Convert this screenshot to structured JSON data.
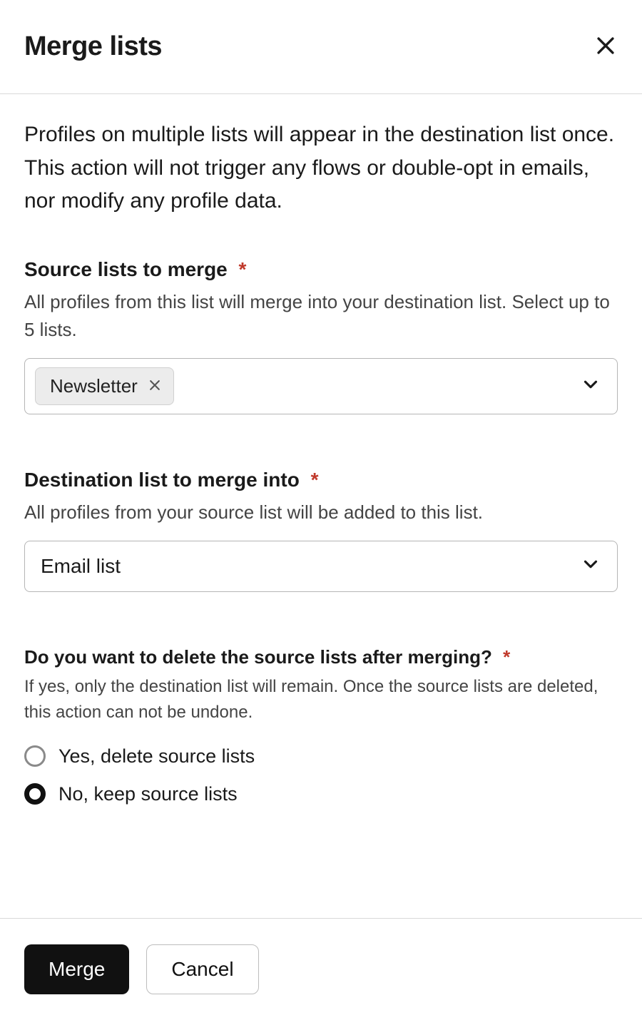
{
  "header": {
    "title": "Merge lists"
  },
  "intro": "Profiles on multiple lists will appear in the destination list once. This action will not trigger any flows or double-opt in emails, nor modify any profile data.",
  "source": {
    "label": "Source lists to merge",
    "required_marker": "*",
    "help": "All profiles from this list will merge into your destination list. Select up to 5 lists.",
    "selected_chips": [
      "Newsletter"
    ]
  },
  "destination": {
    "label": "Destination list to merge into",
    "required_marker": "*",
    "help": "All profiles from your source list will be added to this list.",
    "value": "Email list"
  },
  "delete_question": {
    "label": "Do you want to delete the source lists after merging?",
    "required_marker": "*",
    "help": "If yes, only the destination list will remain. Once the source lists are deleted, this action can not be undone.",
    "options": [
      {
        "label": "Yes, delete source lists",
        "checked": false
      },
      {
        "label": "No, keep source lists",
        "checked": true
      }
    ]
  },
  "footer": {
    "primary": "Merge",
    "secondary": "Cancel"
  }
}
